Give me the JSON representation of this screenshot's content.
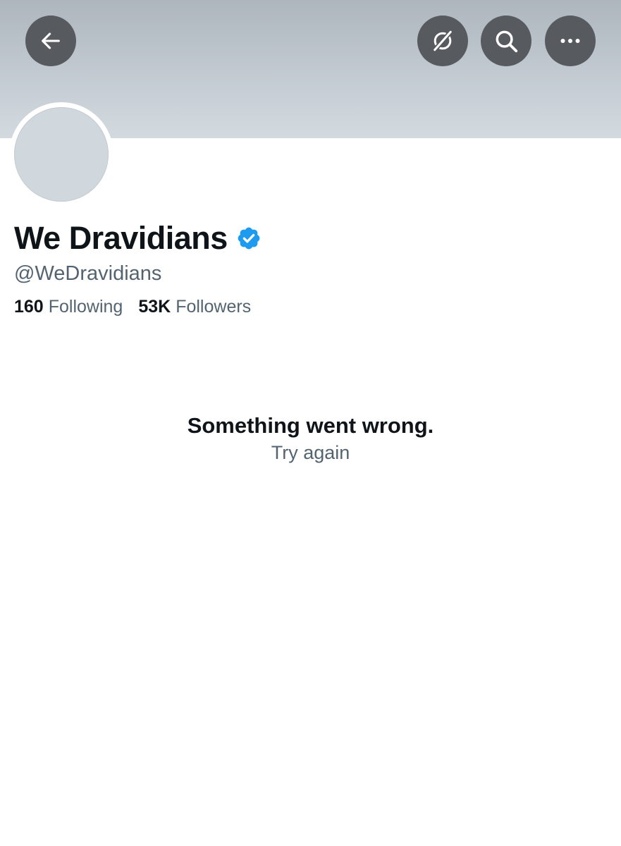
{
  "profile": {
    "display_name": "We Dravidians",
    "verified": true,
    "handle": "@WeDravidians",
    "following_count": "160",
    "following_label": "Following",
    "followers_count": "53K",
    "followers_label": "Followers"
  },
  "toolbar": {
    "back_icon": "arrow-left-icon",
    "grok_icon": "grok-icon",
    "search_icon": "search-icon",
    "more_icon": "more-horizontal-icon"
  },
  "error": {
    "title": "Something went wrong.",
    "retry_label": "Try again"
  },
  "colors": {
    "verified_blue": "#1d9bf0",
    "text_primary": "#0f1419",
    "text_secondary": "#536471",
    "button_bg": "#575b5f"
  }
}
